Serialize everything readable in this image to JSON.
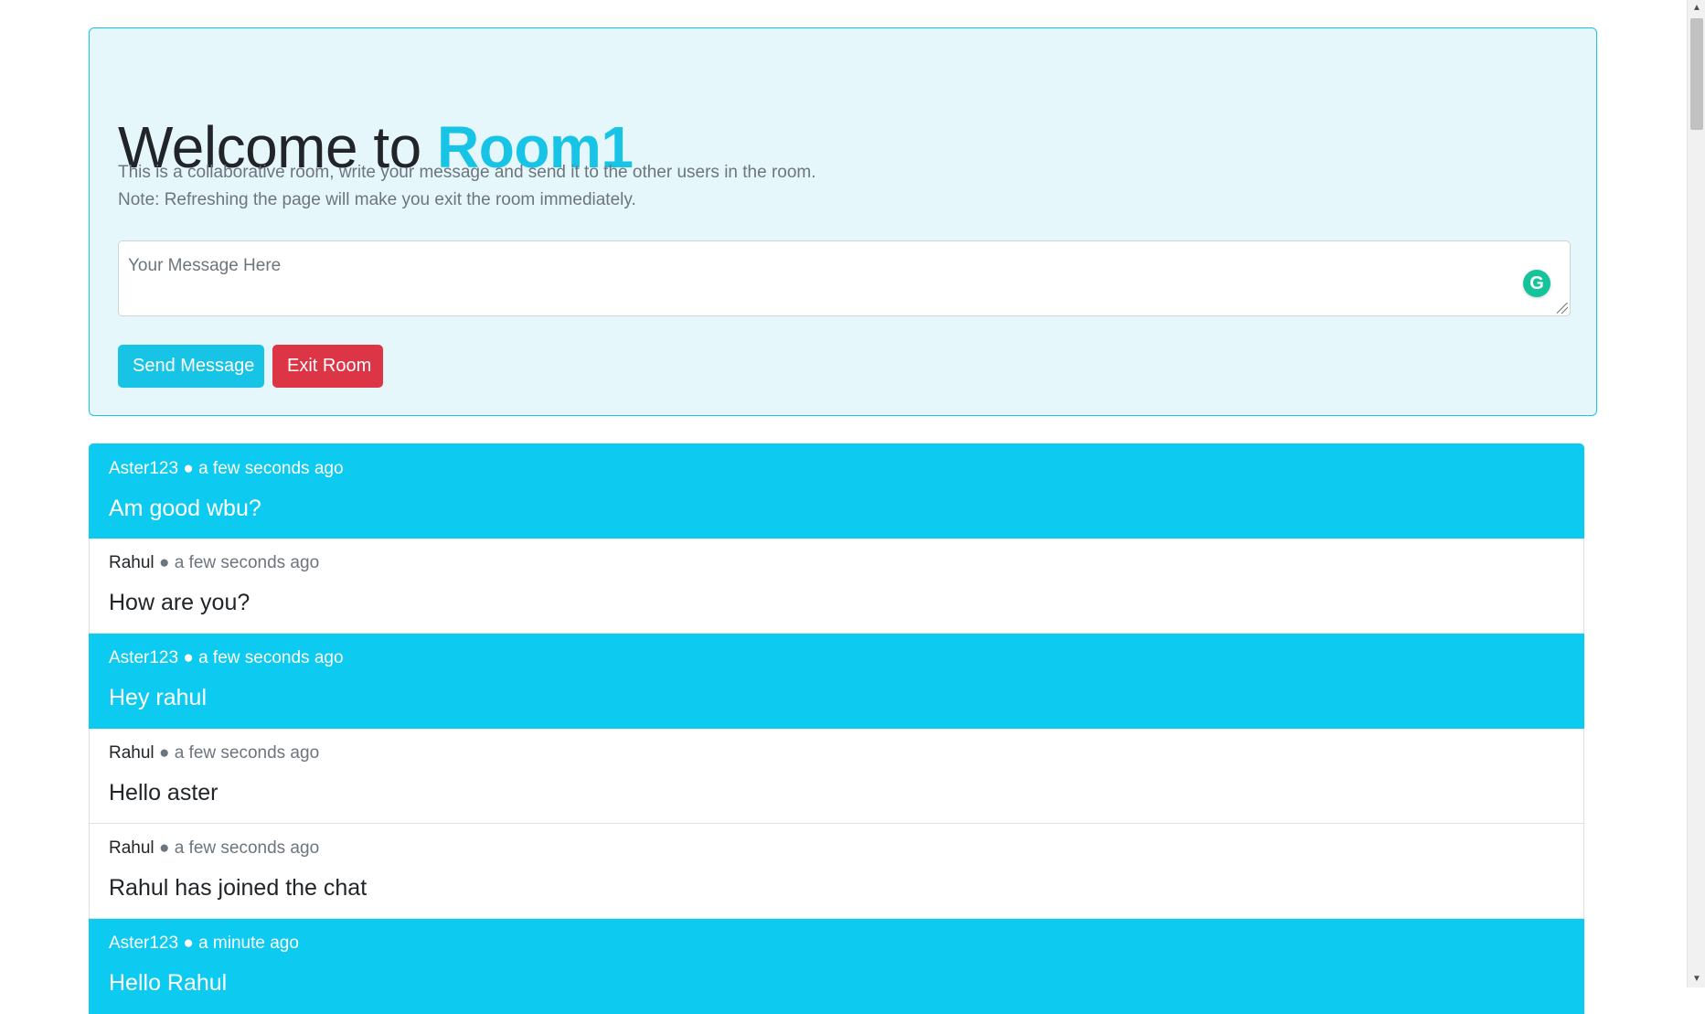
{
  "header": {
    "welcome": "Welcome to",
    "room_name": "Room1",
    "lead_line1": "This is a collaborative room, write your message and send it to the other users in the room.",
    "lead_line2": "Note: Refreshing the page will make you exit the room immediately."
  },
  "composer": {
    "placeholder": "Your Message Here",
    "value": "",
    "grammarly_icon": "G",
    "send_label": "Send Message",
    "exit_label": "Exit Room"
  },
  "messages": [
    {
      "user": "Aster123",
      "time": "● a few seconds ago",
      "text": "Am good wbu?",
      "own": true
    },
    {
      "user": "Rahul",
      "time": "● a few seconds ago",
      "text": "How are you?",
      "own": false
    },
    {
      "user": "Aster123",
      "time": "● a few seconds ago",
      "text": "Hey rahul",
      "own": true
    },
    {
      "user": "Rahul",
      "time": "● a few seconds ago",
      "text": "Hello aster",
      "own": false
    },
    {
      "user": "Rahul",
      "time": "● a few seconds ago",
      "text": "Rahul has joined the chat",
      "own": false
    },
    {
      "user": "Aster123",
      "time": "● a minute ago",
      "text": "Hello Rahul",
      "own": true
    }
  ],
  "scrollbar": {
    "up_icon": "▲",
    "down_icon": "▼"
  },
  "colors": {
    "accent": "#17c4e6",
    "own_message_bg": "#0dcaf0",
    "danger": "#dc3545",
    "jumbotron_bg": "#e6f7fb"
  }
}
